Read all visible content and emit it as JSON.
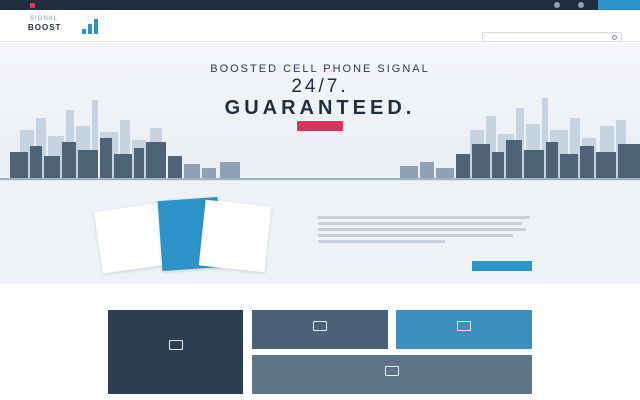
{
  "topbar": {
    "promo": "",
    "phone": ""
  },
  "logo": {
    "line1": "SIGNAL",
    "line2": "BOOST",
    "suffix": ""
  },
  "nav": [
    "",
    "",
    "",
    ""
  ],
  "search": {
    "placeholder": ""
  },
  "social": {
    "colors": [
      "#3b5998",
      "#1da1f2",
      "#0077b5",
      "#dd4b39",
      "#e66a2c",
      "#9aa5b1"
    ]
  },
  "hero": {
    "line1": "BOOSTED CELL PHONE SIGNAL",
    "line2": "24/7.",
    "line3": "GUARANTEED.",
    "cta": "",
    "accent": "#d6345c"
  },
  "report": {
    "kicker": "",
    "title": "",
    "cta": "",
    "accent": "#2e93c9"
  },
  "solutions": {
    "title": "",
    "tiles": [
      "",
      "",
      "",
      ""
    ],
    "tile_colors": [
      "#2d3e52",
      "#4a6278",
      "#3d8fc0",
      "#5e7387"
    ]
  }
}
